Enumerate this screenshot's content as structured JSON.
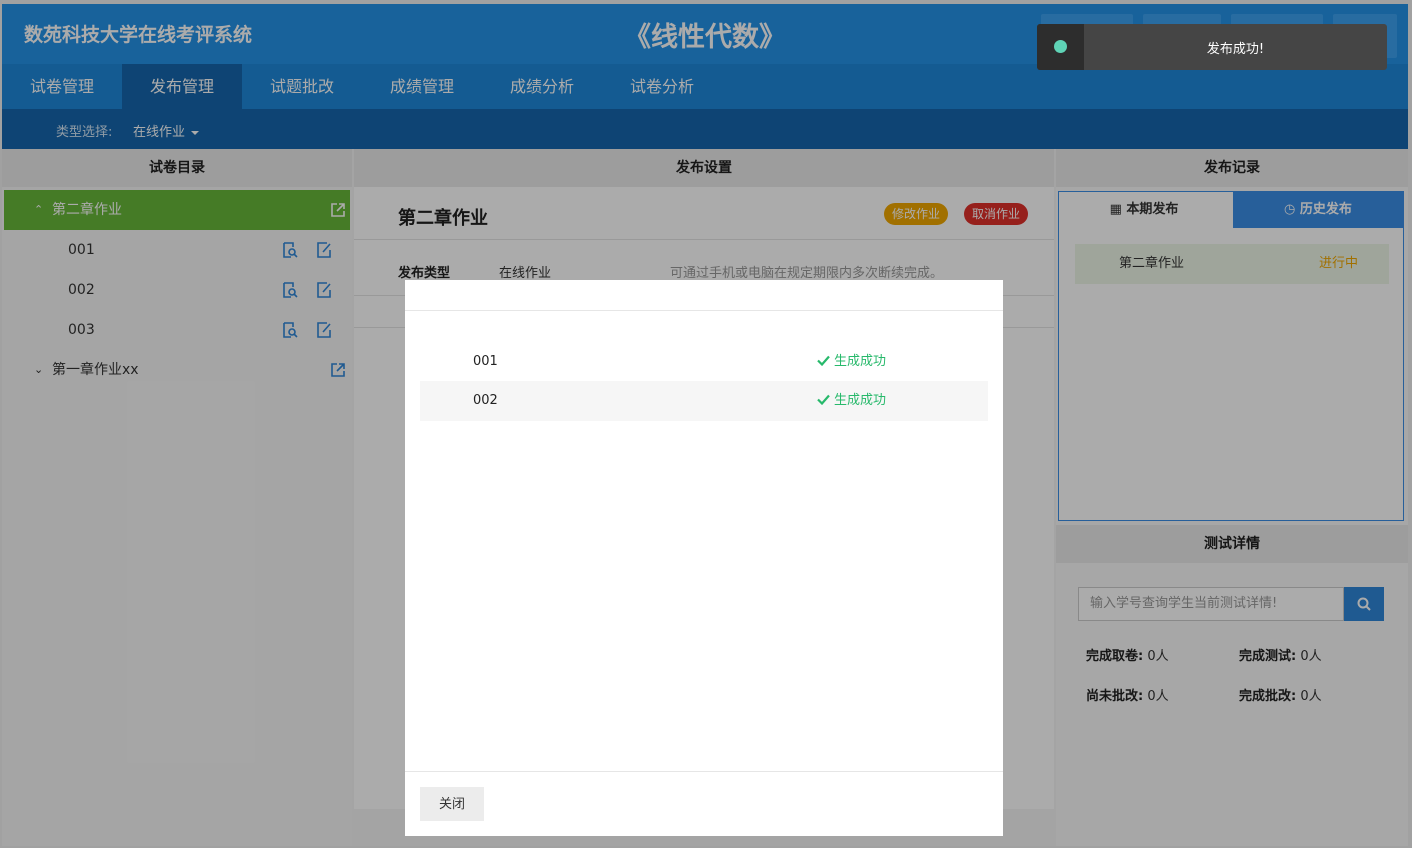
{
  "header": {
    "system_title": "数苑科技大学在线考评系统",
    "course_title": "《线性代数》"
  },
  "nav": {
    "items": [
      {
        "label": "试卷管理"
      },
      {
        "label": "发布管理"
      },
      {
        "label": "试题批改"
      },
      {
        "label": "成绩管理"
      },
      {
        "label": "成绩分析"
      },
      {
        "label": "试卷分析"
      }
    ],
    "active": "发布管理"
  },
  "subbar": {
    "type_label": "类型选择:",
    "type_value": "在线作业"
  },
  "left_panel": {
    "title": "试卷目录",
    "tree": [
      {
        "label": "第二章作业",
        "expanded": true
      },
      {
        "label": "001"
      },
      {
        "label": "002"
      },
      {
        "label": "003"
      },
      {
        "label": "第一章作业xx",
        "expanded": false
      }
    ]
  },
  "center_panel": {
    "title": "发布设置",
    "assignment_title": "第二章作业",
    "modify_label": "修改作业",
    "cancel_label": "取消作业",
    "publish_type_label": "发布类型",
    "publish_type_value": "在线作业",
    "publish_type_hint": "可通过手机或电脑在规定期限内多次断续完成。"
  },
  "right_panel": {
    "title": "发布记录",
    "tab_current": "本期发布",
    "tab_history": "历史发布",
    "record": {
      "name": "第二章作业",
      "status": "进行中"
    },
    "detail_title": "测试详情",
    "search_placeholder": "输入学号查询学生当前测试详情!",
    "stats": [
      {
        "label": "完成取卷:",
        "value": "0人"
      },
      {
        "label": "完成测试:",
        "value": "0人"
      },
      {
        "label": "尚未批改:",
        "value": "0人"
      },
      {
        "label": "完成批改:",
        "value": "0人"
      }
    ]
  },
  "modal": {
    "rows": [
      {
        "name": "001",
        "status": "生成成功"
      },
      {
        "name": "002",
        "status": "生成成功"
      }
    ],
    "close_label": "关闭"
  },
  "toast": {
    "message": "发布成功!"
  },
  "colors": {
    "header_blue": "#2592e8",
    "nav_active": "#1566ad",
    "success_green": "#27b96b",
    "tree_active": "#67b83a",
    "toast_dot": "#5fd3b6"
  }
}
